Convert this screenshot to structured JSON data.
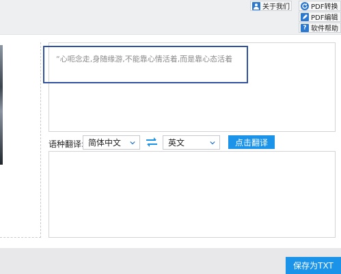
{
  "toolbar": {
    "about_us": {
      "label": "关于我们",
      "icon": "user-icon"
    },
    "pdf_convert": {
      "label": "PDF转换",
      "icon": "refresh-icon"
    },
    "pdf_edit": {
      "label": "PDF编辑",
      "icon": "edit-icon"
    },
    "help": {
      "label": "软件帮助",
      "icon": "help-icon"
    }
  },
  "editor": {
    "source_text": "“心呃念走,身随缘游,不能靠心情活着,而是靠心态活着"
  },
  "translate_row": {
    "label": "语种翻译:",
    "source_lang": "简体中文",
    "target_lang": "英文",
    "translate_button": "点击翻译"
  },
  "footer": {
    "save_button": "保存为TXT"
  },
  "colors": {
    "accent": "#1a93e8",
    "highlight_border": "#2f4fa0"
  }
}
